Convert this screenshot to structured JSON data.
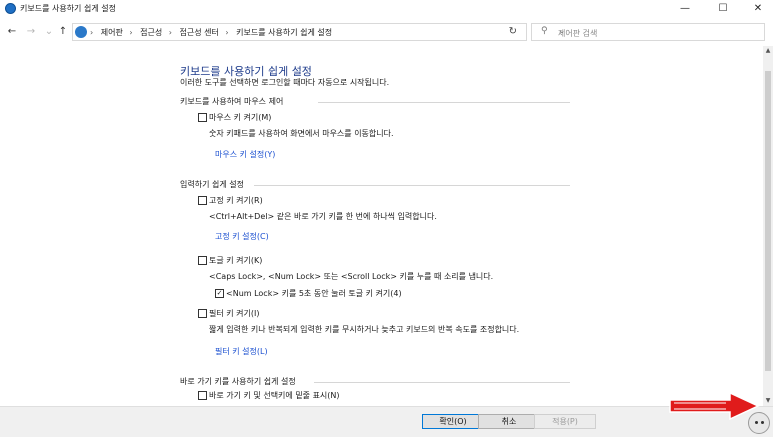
{
  "window": {
    "title": "키보드를 사용하기 쉽게 설정",
    "controls": {
      "minimize": "—",
      "maximize": "☐",
      "close": "✕"
    }
  },
  "nav": {
    "back": "←",
    "forward": "→",
    "up": "↑",
    "breadcrumbs": [
      "제어판",
      "접근성",
      "접근성 센터",
      "키보드를 사용하기 쉽게 설정"
    ],
    "breadcrumb_sep": "›",
    "dropdown": "⌄",
    "refresh": "↻",
    "search_placeholder": "제어판 검색"
  },
  "page": {
    "heading": "키보드를 사용하기 쉽게 설정",
    "subheading": "이러한 도구를 선택하면 로그인할 때마다 자동으로 시작됩니다."
  },
  "sections": {
    "mouse": {
      "title": "키보드를 사용하여 마우스 제어",
      "mousekeys_label": "마우스 키 켜기(M)",
      "mousekeys_desc": "숫자 키패드를 사용하여 화면에서 마우스를 이동합니다.",
      "mousekeys_link": "마우스 키 설정(Y)"
    },
    "typing": {
      "title": "입력하기 쉽게 설정",
      "sticky_label": "고정 키 켜기(R)",
      "sticky_desc": "<Ctrl+Alt+Del> 같은 바로 가기 키를 한 번에 하나씩 입력합니다.",
      "sticky_link": "고정 키 설정(C)",
      "toggle_label": "토글 키 켜기(K)",
      "toggle_desc": "<Caps Lock>, <Num Lock> 또는 <Scroll Lock> 키를 누를 때 소리를 냅니다.",
      "toggle_hold_label": "<Num Lock> 키를 5초 동안 눌러 토글 키 켜기(4)",
      "filter_label": "필터 키 켜기(I)",
      "filter_desc": "짧게 입력한 키나 반복되게 입력한 키를 무시하거나 늦추고 키보드의 반복 속도를 조정합니다.",
      "filter_link": "필터 키 설정(L)"
    },
    "shortcuts": {
      "title": "바로 가기 키를 사용하기 쉽게 설정",
      "underline_label": "바로 가기 키 및 선택키에 밑줄 표시(N)"
    }
  },
  "states": {
    "mousekeys_checked": false,
    "sticky_checked": false,
    "toggle_checked": false,
    "toggle_hold_checked": true,
    "filter_checked": false,
    "underline_checked": false
  },
  "footer": {
    "ok": "확인(O)",
    "cancel": "취소",
    "apply": "적용(P)"
  },
  "colors": {
    "link": "#1a4fd0",
    "heading": "#1c3a8a",
    "accent_red": "#e01b1b"
  },
  "icons": [
    "control-panel-icon",
    "search-icon",
    "refresh-icon",
    "red-arrow-icon",
    "avatar-icon"
  ]
}
